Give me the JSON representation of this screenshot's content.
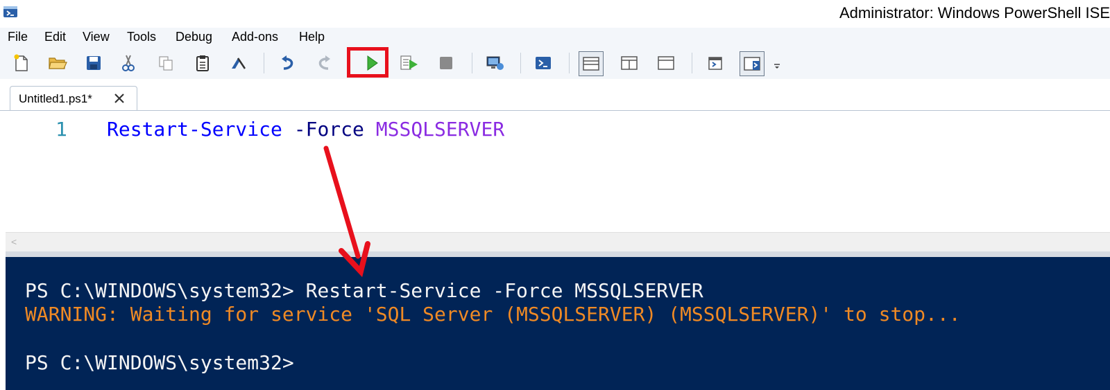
{
  "window": {
    "title": "Administrator: Windows PowerShell ISE",
    "icon": "powershell-ise-icon"
  },
  "menu": [
    {
      "label": "File"
    },
    {
      "label": "Edit"
    },
    {
      "label": "View"
    },
    {
      "label": "Tools"
    },
    {
      "label": "Debug"
    },
    {
      "label": "Add-ons"
    },
    {
      "label": "Help"
    }
  ],
  "toolbar": {
    "buttons": [
      "new-script-icon",
      "open-icon",
      "save-icon",
      "cut-icon",
      "copy-icon",
      "paste-icon",
      "clear-console-icon",
      "undo-icon",
      "redo-icon",
      "run-script-icon",
      "run-selection-icon",
      "stop-icon",
      "new-remote-tab-icon",
      "start-powershell-icon",
      "show-script-pane-top-icon",
      "show-script-pane-right-icon",
      "show-script-pane-max-icon",
      "show-command-window-icon",
      "show-command-addon-icon",
      "customize-toolbar-icon"
    ],
    "highlighted": "run-script-icon",
    "highlight_color": "#e8101c"
  },
  "tabs": [
    {
      "label": "Untitled1.ps1*",
      "active": true
    }
  ],
  "editor": {
    "lines": [
      {
        "number": "1",
        "tokens": {
          "command": "Restart-Service",
          "parameter": "-Force",
          "argument": "MSSQLSERVER"
        }
      }
    ]
  },
  "console": {
    "lines": [
      {
        "type": "command",
        "text": "PS C:\\WINDOWS\\system32> Restart-Service -Force MSSQLSERVER"
      },
      {
        "type": "warning",
        "text": "WARNING: Waiting for service 'SQL Server (MSSQLSERVER) (MSSQLSERVER)' to stop..."
      },
      {
        "type": "prompt",
        "text": "PS C:\\WINDOWS\\system32>"
      }
    ],
    "background": "#012456",
    "warning_color": "#f08a24"
  },
  "annotation": {
    "arrow_color": "#e8101c"
  }
}
